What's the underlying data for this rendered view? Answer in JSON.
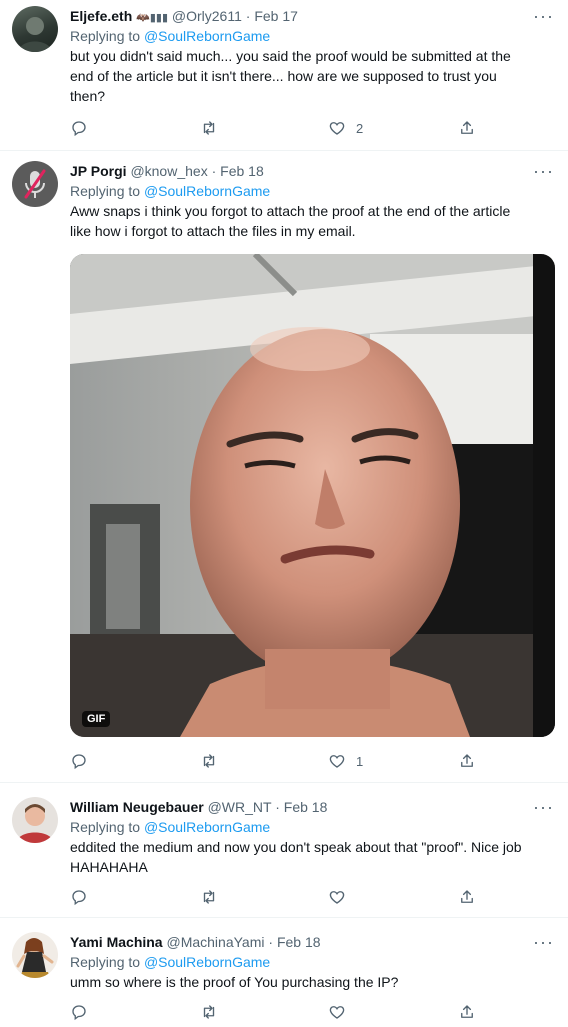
{
  "colors": {
    "accent": "#1d9bf0",
    "text": "#0f1419",
    "muted": "#536471",
    "divider": "#eff3f4"
  },
  "tweets": [
    {
      "name": "Eljefe.eth",
      "badges": "🦇▮▮▮",
      "handle": "@Orly2611",
      "date": "Feb 17",
      "replying_prefix": "Replying to ",
      "replying_to": "@SoulRebornGame",
      "text_lines": [
        "but you didn't said much... you said the proof would be submitted at the",
        "end of the article but it isn't there... how are we supposed to trust you",
        "then?"
      ],
      "likes": "2"
    },
    {
      "name": "JP Porgi",
      "handle": "@know_hex",
      "date": "Feb 18",
      "replying_prefix": "Replying to ",
      "replying_to": "@SoulRebornGame",
      "text_lines": [
        "Aww snaps i think you forgot to attach the proof at the end of the article",
        "like how i forgot to attach the files in my email."
      ],
      "media_badge": "GIF",
      "likes": "1"
    },
    {
      "name": "William Neugebauer",
      "handle": "@WR_NT",
      "date": "Feb 18",
      "replying_prefix": "Replying to ",
      "replying_to": "@SoulRebornGame",
      "text_lines": [
        "eddited the medium and now you don't speak about that \"proof\". Nice job",
        "HAHAHAHA"
      ],
      "likes": ""
    },
    {
      "name": "Yami Machina",
      "handle": "@MachinaYami",
      "date": "Feb 18",
      "replying_prefix": "Replying to ",
      "replying_to": "@SoulRebornGame",
      "text_lines": [
        "umm so where is the proof of You purchasing the IP?"
      ],
      "likes": ""
    }
  ],
  "icons": {
    "reply": "reply-icon",
    "retweet": "retweet-icon",
    "like": "like-icon",
    "share": "share-icon",
    "more": "more-icon"
  }
}
